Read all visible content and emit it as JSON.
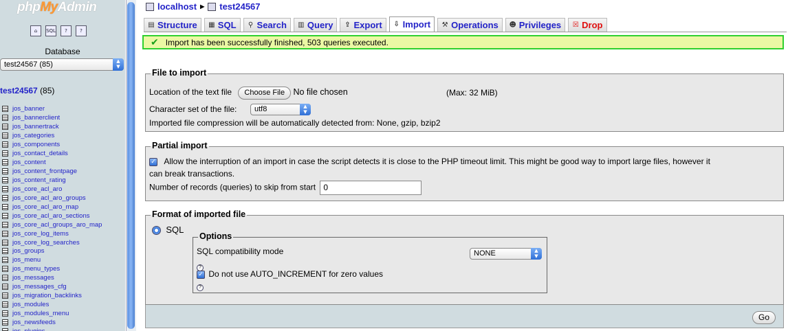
{
  "sidebar": {
    "logo": {
      "php": "php",
      "my": "My",
      "admin": "Admin"
    },
    "icons": [
      "home-icon",
      "sql-query-icon",
      "documentation-icon",
      "help-icon"
    ],
    "database_label": "Database",
    "database_select": "test24567 (85)",
    "current_db": {
      "name": "test24567",
      "count": "(85)"
    },
    "tables": [
      "jos_banner",
      "jos_bannerclient",
      "jos_bannertrack",
      "jos_categories",
      "jos_components",
      "jos_contact_details",
      "jos_content",
      "jos_content_frontpage",
      "jos_content_rating",
      "jos_core_acl_aro",
      "jos_core_acl_aro_groups",
      "jos_core_acl_aro_map",
      "jos_core_acl_aro_sections",
      "jos_core_acl_groups_aro_map",
      "jos_core_log_items",
      "jos_core_log_searches",
      "jos_groups",
      "jos_menu",
      "jos_menu_types",
      "jos_messages",
      "jos_messages_cfg",
      "jos_migration_backlinks",
      "jos_modules",
      "jos_modules_menu",
      "jos_newsfeeds",
      "jos_plugins"
    ]
  },
  "breadcrumb": {
    "server": "localhost",
    "database": "test24567"
  },
  "tabs": [
    {
      "label": "Structure",
      "icon": "structure-icon"
    },
    {
      "label": "SQL",
      "icon": "sql-icon"
    },
    {
      "label": "Search",
      "icon": "search-icon"
    },
    {
      "label": "Query",
      "icon": "query-icon"
    },
    {
      "label": "Export",
      "icon": "export-icon"
    },
    {
      "label": "Import",
      "icon": "import-icon",
      "active": true
    },
    {
      "label": "Operations",
      "icon": "operations-icon"
    },
    {
      "label": "Privileges",
      "icon": "privileges-icon"
    },
    {
      "label": "Drop",
      "icon": "drop-icon",
      "danger": true
    }
  ],
  "message": "Import has been successfully finished, 503 queries executed.",
  "file_to_import": {
    "legend": "File to import",
    "location_label": "Location of the text file",
    "choose_button": "Choose File",
    "no_file": "No file chosen",
    "max": "(Max: 32 MiB)",
    "charset_label": "Character set of the file:",
    "charset_value": "utf8",
    "compression_note": "Imported file compression will be automatically detected from: None, gzip, bzip2"
  },
  "partial_import": {
    "legend": "Partial import",
    "allow_interrupt_line1": "Allow the interruption of an import in case the script detects it is close to the PHP timeout limit. This might be good way to import large files, however it",
    "allow_interrupt_line2": "can break transactions.",
    "skip_label": "Number of records (queries) to skip from start",
    "skip_value": "0"
  },
  "format": {
    "legend": "Format of imported file",
    "sql_label": "SQL",
    "options_legend": "Options",
    "compat_label": "SQL compatibility mode",
    "compat_value": "NONE",
    "auto_increment_label": "Do not use AUTO_INCREMENT for zero values"
  },
  "go_button": "Go",
  "colors": {
    "success_border": "#2fd02f",
    "success_bg": "#ebf8a4",
    "link": "#2323c8",
    "nav_bg": "#d0dce0"
  }
}
